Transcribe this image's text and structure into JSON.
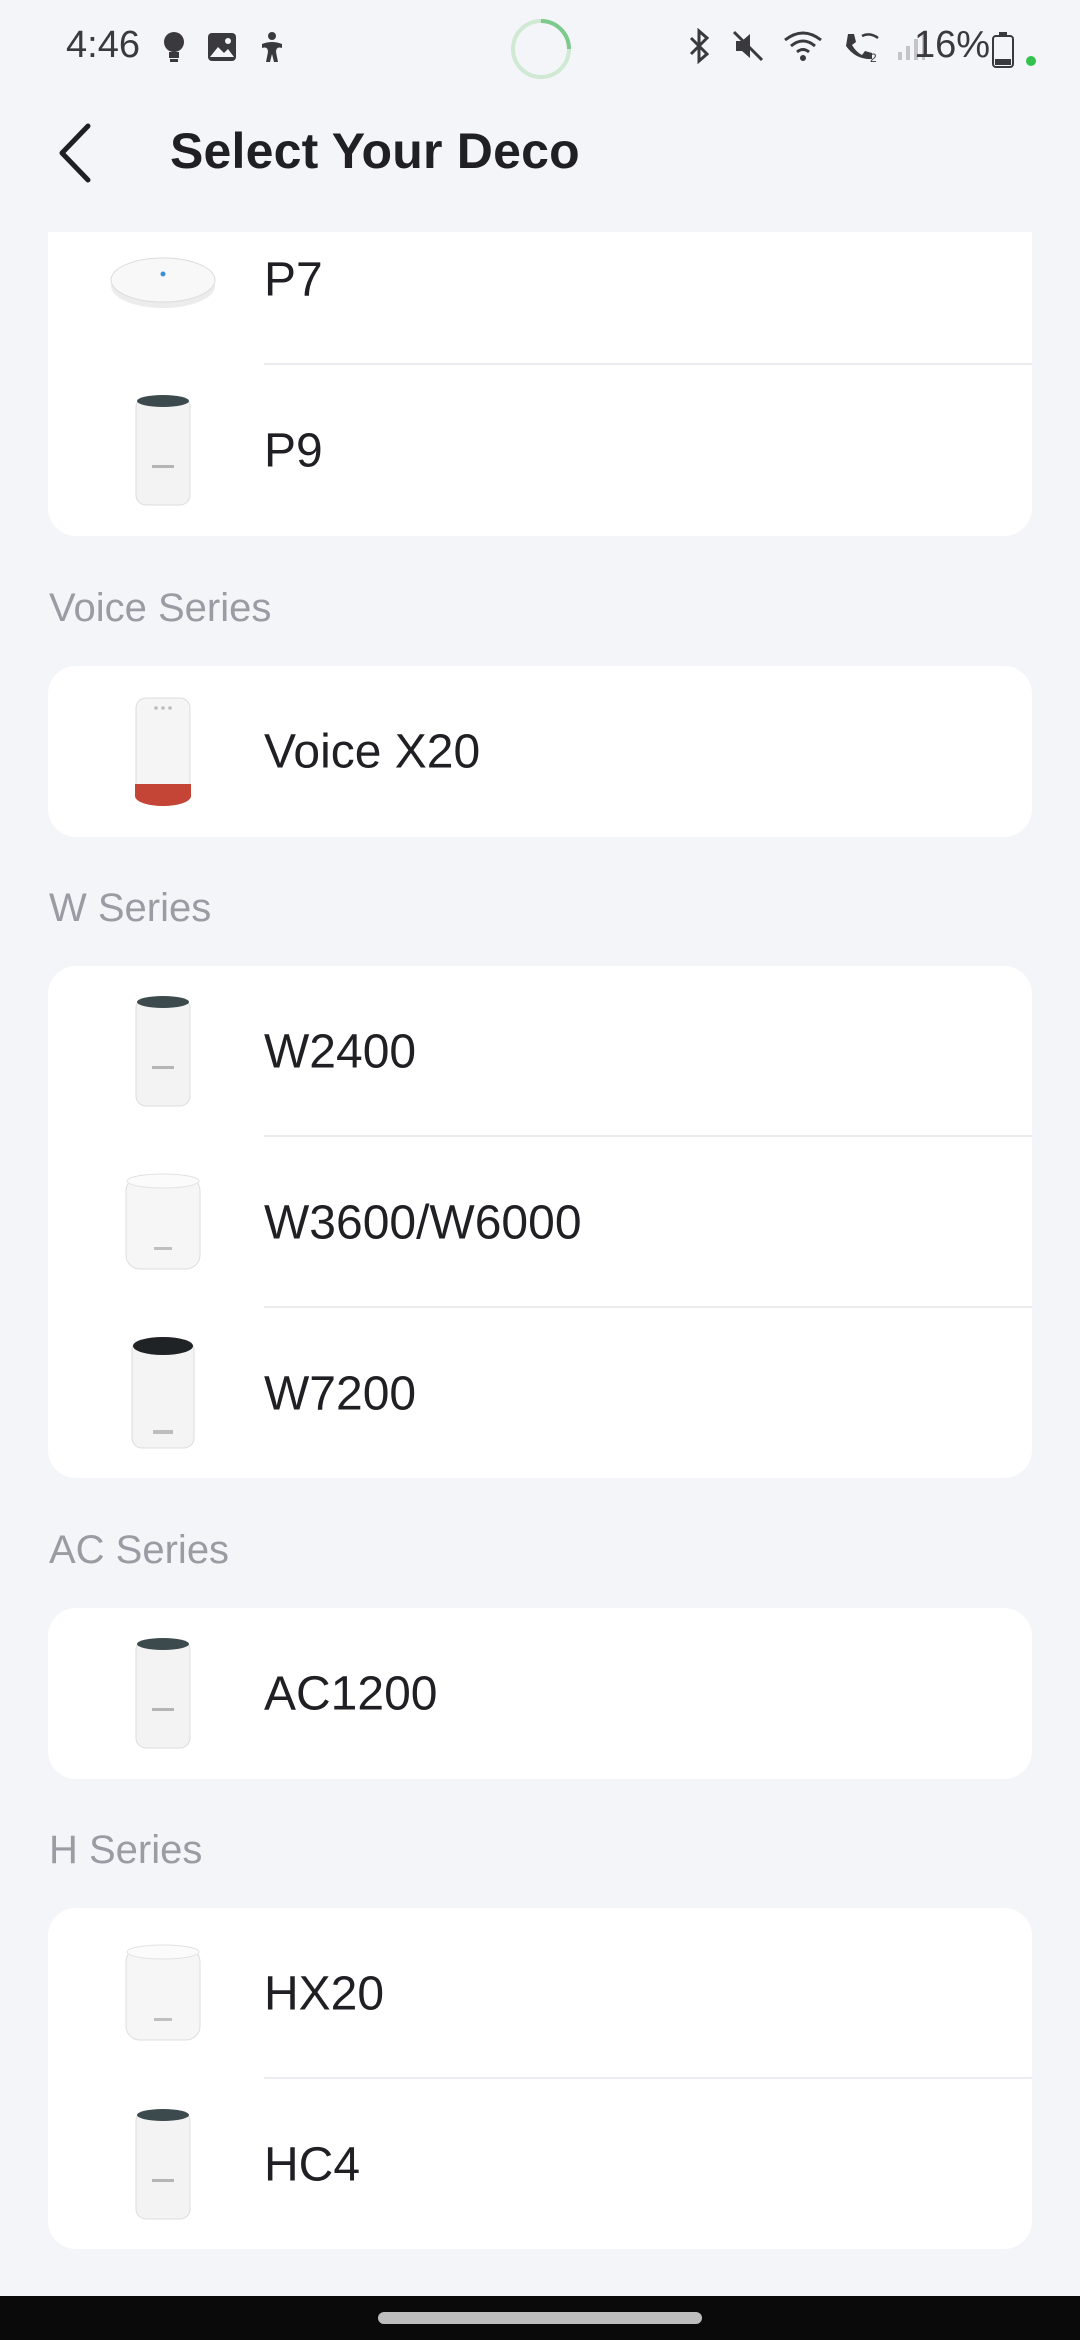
{
  "status_bar": {
    "time": "4:46",
    "battery_percent": "16%",
    "icons_left": [
      "bulb-icon",
      "gallery-icon",
      "accessibility-icon"
    ],
    "icons_right": [
      "bluetooth-icon",
      "mute-icon",
      "wifi-icon",
      "wifi-calling-icon",
      "signal-icon",
      "battery-icon"
    ]
  },
  "header": {
    "title": "Select Your Deco",
    "back_icon": "chevron-left-icon"
  },
  "cards": [
    {
      "section_label": "",
      "items": [
        {
          "name": "P7",
          "thumb": "disc"
        },
        {
          "name": "P9",
          "thumb": "tower-dark-top"
        }
      ]
    },
    {
      "section_label": "Voice Series",
      "items": [
        {
          "name": "Voice X20",
          "thumb": "tower-red-base"
        }
      ]
    },
    {
      "section_label": "W Series",
      "items": [
        {
          "name": "W2400",
          "thumb": "tower-dark-top"
        },
        {
          "name": "W3600/W6000",
          "thumb": "tower-white"
        },
        {
          "name": "W7200",
          "thumb": "tower-black-top"
        }
      ]
    },
    {
      "section_label": "AC Series",
      "items": [
        {
          "name": "AC1200",
          "thumb": "tower-dark-top"
        }
      ]
    },
    {
      "section_label": "H Series",
      "items": [
        {
          "name": "HX20",
          "thumb": "tower-white"
        },
        {
          "name": "HC4",
          "thumb": "tower-dark-top"
        }
      ]
    }
  ],
  "colors": {
    "background": "#f4f5f9",
    "card": "#ffffff",
    "section_label": "#9a9ca4",
    "text": "#1f1f24"
  }
}
